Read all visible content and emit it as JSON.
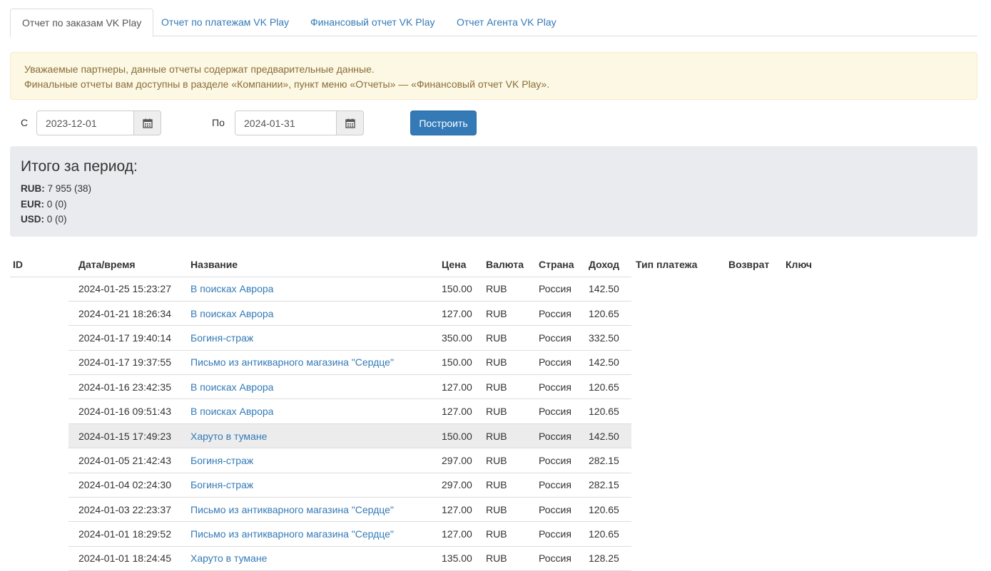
{
  "tabs": [
    {
      "label": "Отчет по заказам VK Play",
      "active": true
    },
    {
      "label": "Отчет по платежам VK Play",
      "active": false
    },
    {
      "label": "Финансовый отчет VK Play",
      "active": false
    },
    {
      "label": "Отчет Агента VK Play",
      "active": false
    }
  ],
  "alert": {
    "line1": "Уважаемые партнеры, данные отчеты содержат предварительные данные.",
    "line2": "Финальные отчеты вам доступны в разделе «Компании», пункт меню «Отчеты» — «Финансовый отчет VK Play»."
  },
  "filter": {
    "from_label": "С",
    "from_value": "2023-12-01",
    "to_label": "По",
    "to_value": "2024-01-31",
    "build_label": "Построить",
    "calendar_icon": "calendar-icon"
  },
  "totals": {
    "title": "Итого за период:",
    "rows": [
      {
        "currency": "RUB:",
        "value": "7 955 (38)"
      },
      {
        "currency": "EUR:",
        "value": "0 (0)"
      },
      {
        "currency": "USD:",
        "value": "0 (0)"
      }
    ]
  },
  "table": {
    "headers": {
      "id": "ID",
      "date": "Дата/время",
      "name": "Название",
      "price": "Цена",
      "currency": "Валюта",
      "country": "Страна",
      "income": "Доход",
      "payment_type": "Тип платежа",
      "refund": "Возврат",
      "key": "Ключ"
    },
    "rows": [
      {
        "id": "",
        "date": "2024-01-25 15:23:27",
        "name": "В поисках Аврора",
        "price": "150.00",
        "currency": "RUB",
        "country": "Россия",
        "income": "142.50"
      },
      {
        "id": "",
        "date": "2024-01-21 18:26:34",
        "name": "В поисках Аврора",
        "price": "127.00",
        "currency": "RUB",
        "country": "Россия",
        "income": "120.65"
      },
      {
        "id": "",
        "date": "2024-01-17 19:40:14",
        "name": "Богиня-страж",
        "price": "350.00",
        "currency": "RUB",
        "country": "Россия",
        "income": "332.50"
      },
      {
        "id": "",
        "date": "2024-01-17 19:37:55",
        "name": "Письмо из антикварного магазина \"Сердце\"",
        "price": "150.00",
        "currency": "RUB",
        "country": "Россия",
        "income": "142.50"
      },
      {
        "id": "",
        "date": "2024-01-16 23:42:35",
        "name": "В поисках Аврора",
        "price": "127.00",
        "currency": "RUB",
        "country": "Россия",
        "income": "120.65"
      },
      {
        "id": "",
        "date": "2024-01-16 09:51:43",
        "name": "В поисках Аврора",
        "price": "127.00",
        "currency": "RUB",
        "country": "Россия",
        "income": "120.65"
      },
      {
        "id": "",
        "date": "2024-01-15 17:49:23",
        "name": "Харуто в тумане",
        "price": "150.00",
        "currency": "RUB",
        "country": "Россия",
        "income": "142.50",
        "highlighted": true
      },
      {
        "id": "",
        "date": "2024-01-05 21:42:43",
        "name": "Богиня-страж",
        "price": "297.00",
        "currency": "RUB",
        "country": "Россия",
        "income": "282.15"
      },
      {
        "id": "",
        "date": "2024-01-04 02:24:30",
        "name": "Богиня-страж",
        "price": "297.00",
        "currency": "RUB",
        "country": "Россия",
        "income": "282.15"
      },
      {
        "id": "",
        "date": "2024-01-03 22:23:37",
        "name": "Письмо из антикварного магазина \"Сердце\"",
        "price": "127.00",
        "currency": "RUB",
        "country": "Россия",
        "income": "120.65"
      },
      {
        "id": "",
        "date": "2024-01-01 18:29:52",
        "name": "Письмо из антикварного магазина \"Сердце\"",
        "price": "127.00",
        "currency": "RUB",
        "country": "Россия",
        "income": "120.65"
      },
      {
        "id": "",
        "date": "2024-01-01 18:24:45",
        "name": "Харуто в тумане",
        "price": "135.00",
        "currency": "RUB",
        "country": "Россия",
        "income": "128.25"
      }
    ]
  }
}
